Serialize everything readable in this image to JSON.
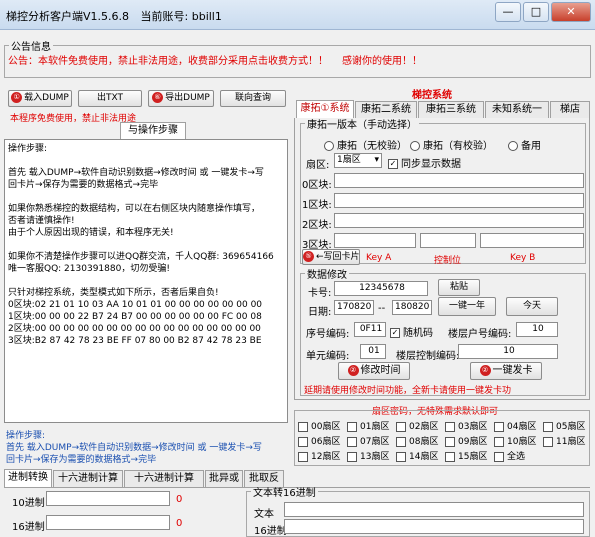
{
  "window": {
    "title": "梯控分析客户端V1.5.6.8",
    "account_label": "当前账号:",
    "account": "bbill1",
    "min": "—",
    "max": "□",
    "close": "✕"
  },
  "announcement": {
    "legend": "公告信息",
    "text": "公告：本软件免费使用，禁止非法用途，收费部分采用点击收费方式！！",
    "thanks": "感谢你的使用！！"
  },
  "toolbar": {
    "load_dump": "载入DUMP",
    "load_badge": "①",
    "export_txt": "出TXT",
    "export_dump": "导出DUMP",
    "export_badge": "⑥",
    "other": "联向查询"
  },
  "notice_line": "本程序免费使用，禁止非法用途",
  "steps_tab": "与操作步骤",
  "main_text": "操作步骤:\n\n首先 载入DUMP→软件自动识别数据→修改时间 或 一键发卡→写\n回卡片→保存为需要的数据格式→完毕\n\n如果你熟悉梯控的数据结构，可以在右侧区块内随意操作填写，\n否者请谨慎操作!\n由于个人原因出现的错误，和本程序无关!\n\n如果你不清楚操作步骤可以进QQ群交流，千人QQ群: 369654166\n唯一客服QQ: 2130391880，切勿受骗!\n\n只针对梯控系统，类型模式如下所示，否者后果自负!\n0区块:02 21 01 10 03 AA 10 01 01 00 00 00 00 00 00 00\n1区块:00 00 00 22 B7 24 B7 00 00 00 00 00 00 FC 00 08\n2区块:00 00 00 00 00 00 00 00 00 00 00 00 00 00 00 00\n3区块:B2 87 42 78 23 BE FF 07 80 00 B2 87 42 78 23 BE",
  "bottom_steps": {
    "title": "操作步骤:",
    "line1": "首先 载入DUMP→软件自动识别数据→修改时间 或 一键发卡→写",
    "line2": "回卡片→保存为需要的数据格式→完毕"
  },
  "right": {
    "system_title": "梯控系统",
    "tabs": [
      "康拓①系统",
      "康拓二系统",
      "康拓三系统",
      "未知系统一",
      "梯店"
    ],
    "version_legend": "康拓一版本（手动选择）",
    "radios": [
      "康拓（无校验）",
      "康拓（有校验）",
      "备用"
    ],
    "sector_label": "扇区:",
    "sector_value": "1扇区",
    "sync_label": "同步显示数据",
    "blocks": [
      "0区块:",
      "1区块:",
      "2区块:",
      "3区块:"
    ],
    "write_back": "←写回卡片",
    "write_badge": "⑤",
    "key_a": "Key A",
    "control_bits": "控制位",
    "key_b": "Key B"
  },
  "data_edit": {
    "legend": "数据修改",
    "card_label": "卡号:",
    "card_value": "12345678",
    "paste": "粘贴",
    "date_label": "日期:",
    "date_from": "170820",
    "date_sep": "--",
    "date_to": "180820",
    "one_year": "一键一年",
    "today": "今天",
    "serial_label": "序号编码:",
    "serial_value": "0F11",
    "random_label": "随机码",
    "floor_label": "楼层户号编码:",
    "floor_value": "10",
    "unit_label": "单元编码:",
    "unit_value": "01",
    "floor_ctrl_label": "楼层控制编码:",
    "floor_ctrl_value": "10",
    "modify_time": "修改时间",
    "modify_badge": "②",
    "issue_card": "一键发卡",
    "issue_badge": "②",
    "hint": "延期请使用修改时间功能，全新卡请使用一键发卡功"
  },
  "sector_pwd": {
    "title": "扇区密码，无特殊需求默认即可",
    "items": [
      "00扇区",
      "01扇区",
      "02扇区",
      "03扇区",
      "04扇区",
      "05扇区",
      "06扇区",
      "07扇区",
      "08扇区",
      "09扇区",
      "10扇区",
      "11扇区",
      "12扇区",
      "13扇区",
      "14扇区",
      "15扇区",
      "全选"
    ]
  },
  "conv": {
    "tabs": [
      "进制转换",
      "十六进制计算",
      "十六进制计算",
      "批异或",
      "批取反"
    ],
    "dec_label": "10进制",
    "hex_label": "16进制",
    "dec_value": "0",
    "hex_value": "0",
    "text_legend": "文本转16进制",
    "text_label": "文本",
    "text_hex_label": "16进制"
  }
}
